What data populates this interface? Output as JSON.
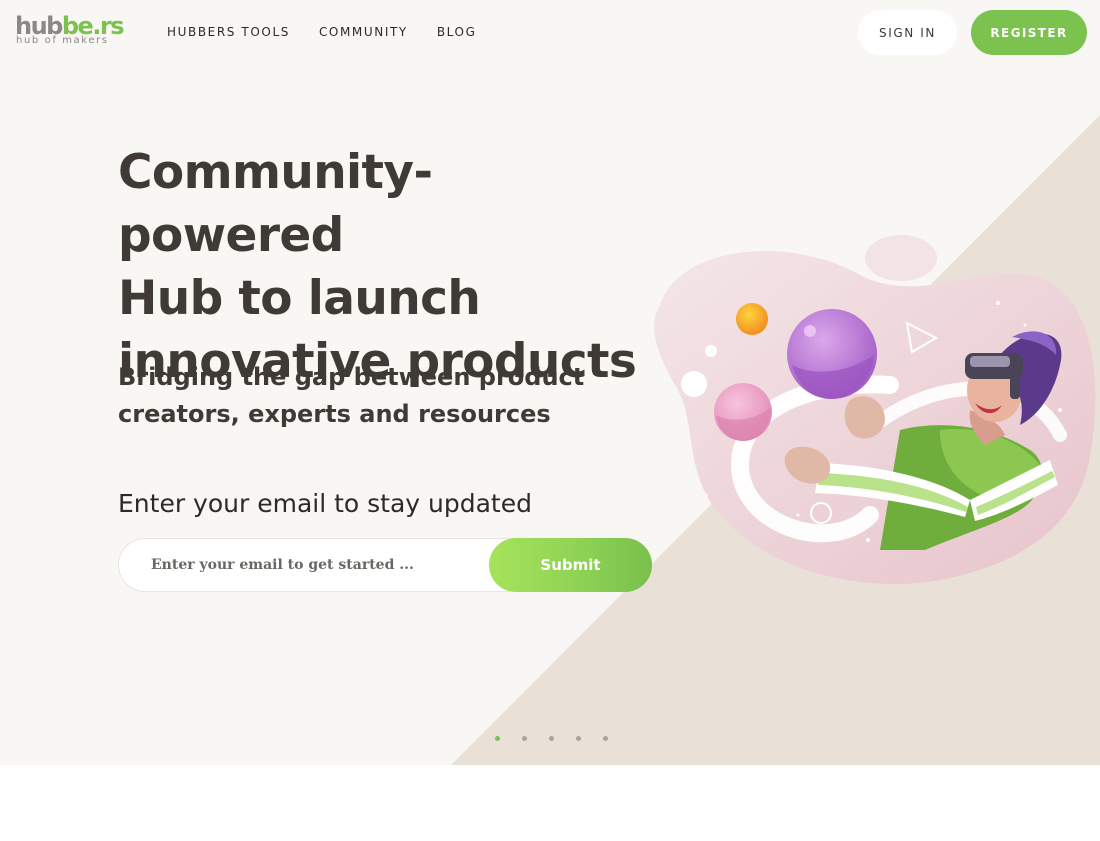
{
  "header": {
    "logo_main_grey": "hub",
    "logo_main_green": "be.rs",
    "logo_tagline": "hub of makers",
    "nav": [
      {
        "label": "HUBBERS TOOLS"
      },
      {
        "label": "COMMUNITY"
      },
      {
        "label": "BLOG"
      }
    ],
    "signin_label": "SIGN IN",
    "register_label": "REGISTER"
  },
  "hero": {
    "headline_lines": [
      "Community-powered",
      "Hub to launch",
      "innovative products"
    ],
    "subline_lines": [
      "Bridging the gap between product",
      "creators, experts and resources"
    ],
    "email_prompt": "Enter your email to stay updated",
    "email_placeholder": "Enter your email to get started ...",
    "submit_label": "Submit"
  },
  "carousel": {
    "slide_count": 5,
    "active_index": 0
  },
  "colors": {
    "brand_green": "#7cc24e",
    "text_dark": "#3f3a36",
    "hero_bg": "#f8f7f4",
    "diagonal_bg": "#e9e1d8",
    "blob_pink": "#edd3d6"
  }
}
